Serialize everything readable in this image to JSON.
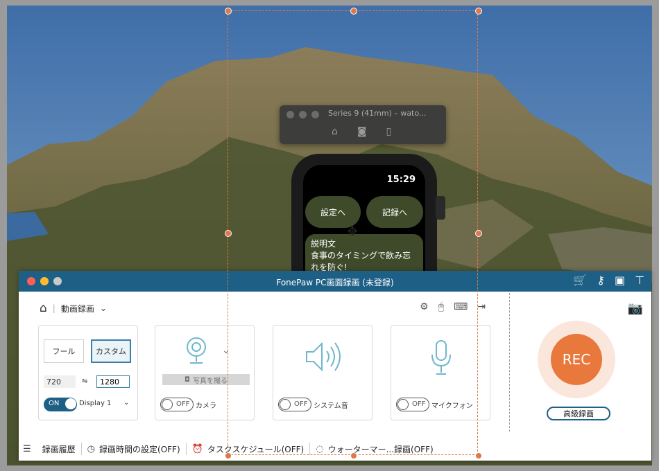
{
  "simulator": {
    "title": "Series 9 (41mm) – wato...",
    "icons": [
      "home-icon",
      "screenshot-icon",
      "rotate-icon"
    ],
    "watch": {
      "time": "15:29",
      "button_left": "設定へ",
      "button_right": "記録へ",
      "description_title": "説明文",
      "description_body": "食事のタイミングで飲み忘れを防ぐ!"
    }
  },
  "app": {
    "title": "FonePaw PC画面録画 (未登録)",
    "titlebar_icons": [
      "cart-icon",
      "key-icon",
      "chat-icon",
      "pin-icon"
    ],
    "mode_label": "動画録画",
    "area": {
      "full_label": "フール",
      "custom_label": "カスタム",
      "height_value": "720",
      "width_value": "1280",
      "display_toggle": "ON",
      "display_label": "Display 1"
    },
    "camera": {
      "photo_label": "写真を撮る",
      "toggle": "OFF",
      "label": "カメラ"
    },
    "system_sound": {
      "toggle": "OFF",
      "label": "システム音"
    },
    "microphone": {
      "toggle": "OFF",
      "label": "マイクフォン"
    },
    "rec_label": "REC",
    "advanced_label": "高級録画",
    "bottom_bar": {
      "history": "録画履歴",
      "timer": "録画時間の設定(OFF)",
      "schedule": "タスクスケジュール(OFF)",
      "watermark": "ウォーターマー...録画(OFF)"
    }
  },
  "colors": {
    "titlebar": "#1e5f85",
    "rec": "#e8783c",
    "selection": "#e0784a",
    "icon_blue": "#6eb7cf"
  }
}
